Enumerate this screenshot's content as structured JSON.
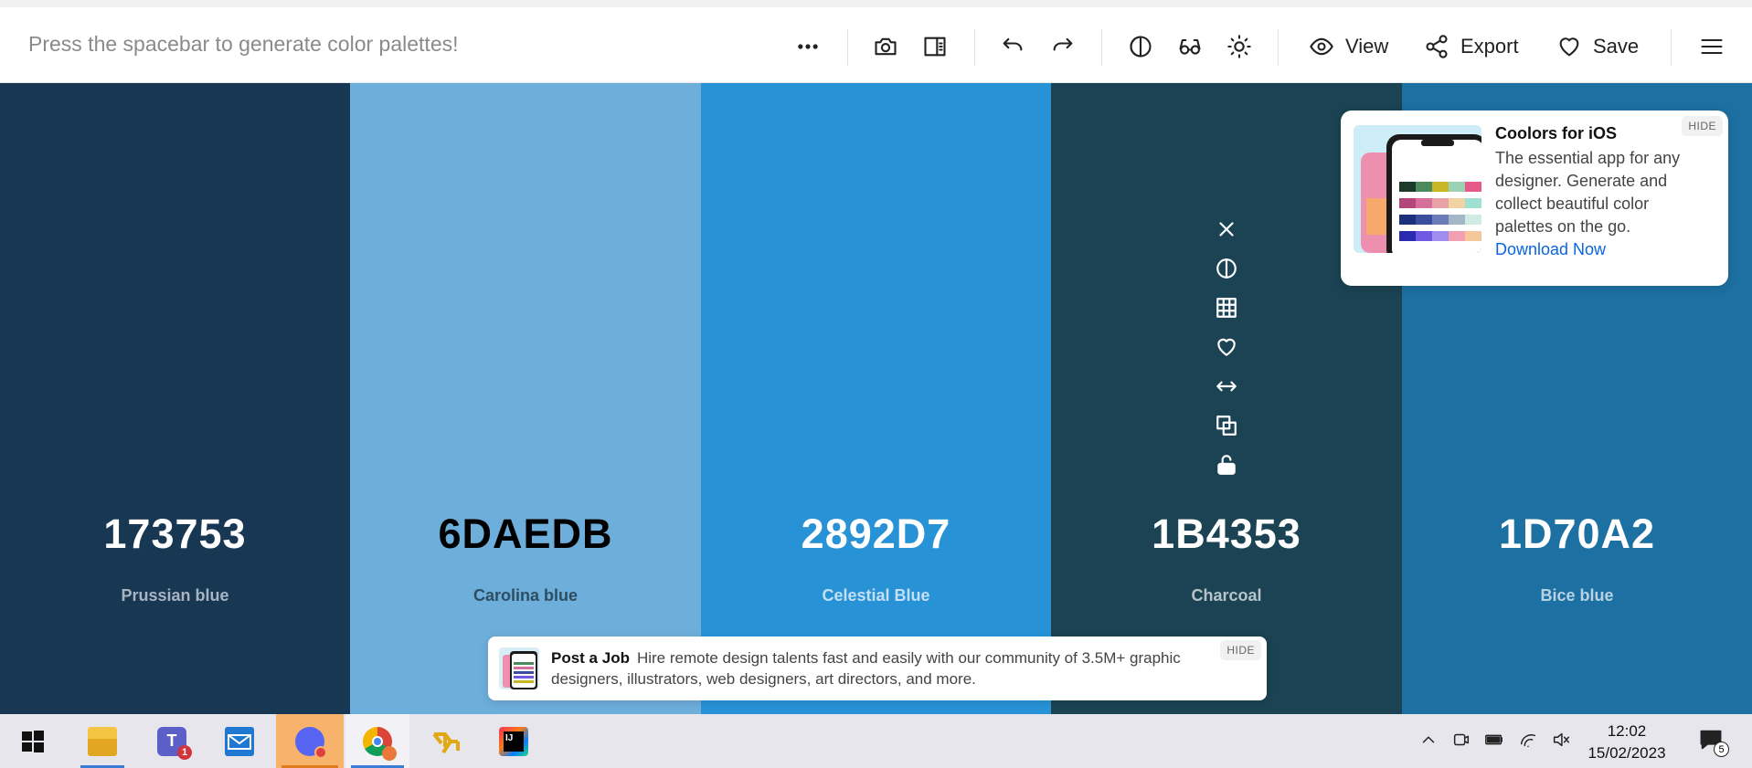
{
  "toolbar": {
    "hint": "Press the spacebar to generate color palettes!",
    "view_label": "View",
    "export_label": "Export",
    "save_label": "Save"
  },
  "palette": [
    {
      "hex": "173753",
      "name": "Prussian blue",
      "color": "#173753",
      "text": "#ffffff",
      "subtext": "#a8b4c0"
    },
    {
      "hex": "6DAEDB",
      "name": "Carolina blue",
      "color": "#6DAEDB",
      "text": "#000000",
      "subtext": "#2d4e62"
    },
    {
      "hex": "2892D7",
      "name": "Celestial Blue",
      "color": "#2892D7",
      "text": "#ffffff",
      "subtext": "#c2dff3"
    },
    {
      "hex": "1B4353",
      "name": "Charcoal",
      "color": "#1B4353",
      "text": "#ffffff",
      "subtext": "#b7c5cb"
    },
    {
      "hex": "1D70A2",
      "name": "Bice blue",
      "color": "#1D70A2",
      "text": "#ffffff",
      "subtext": "#b9d2e3"
    }
  ],
  "ios_ad": {
    "title": "Coolors for iOS",
    "description": "The essential app for any designer. Generate and collect beautiful color palettes on the go.",
    "link": "Download Now",
    "hide": "HIDE"
  },
  "job_ad": {
    "title": "Post a Job",
    "text": "Hire remote design talents fast and easily with our community of 3.5M+ graphic designers, illustrators, web designers, art directors, and more.",
    "hide": "HIDE"
  },
  "taskbar": {
    "teams_badge": "1",
    "notifications_badge": "5",
    "time": "12:02",
    "date": "15/02/2023"
  }
}
